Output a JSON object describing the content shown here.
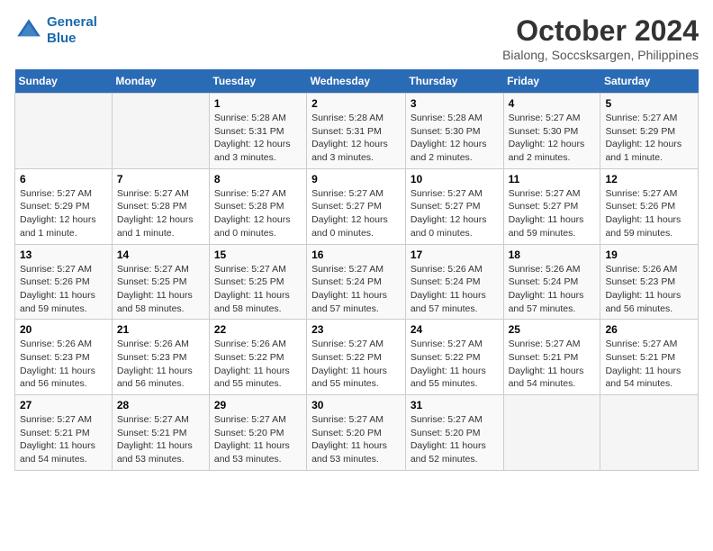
{
  "header": {
    "logo_line1": "General",
    "logo_line2": "Blue",
    "month": "October 2024",
    "location": "Bialong, Soccsksargen, Philippines"
  },
  "weekdays": [
    "Sunday",
    "Monday",
    "Tuesday",
    "Wednesday",
    "Thursday",
    "Friday",
    "Saturday"
  ],
  "weeks": [
    [
      {
        "day": "",
        "info": ""
      },
      {
        "day": "",
        "info": ""
      },
      {
        "day": "1",
        "info": "Sunrise: 5:28 AM\nSunset: 5:31 PM\nDaylight: 12 hours and 3 minutes."
      },
      {
        "day": "2",
        "info": "Sunrise: 5:28 AM\nSunset: 5:31 PM\nDaylight: 12 hours and 3 minutes."
      },
      {
        "day": "3",
        "info": "Sunrise: 5:28 AM\nSunset: 5:30 PM\nDaylight: 12 hours and 2 minutes."
      },
      {
        "day": "4",
        "info": "Sunrise: 5:27 AM\nSunset: 5:30 PM\nDaylight: 12 hours and 2 minutes."
      },
      {
        "day": "5",
        "info": "Sunrise: 5:27 AM\nSunset: 5:29 PM\nDaylight: 12 hours and 1 minute."
      }
    ],
    [
      {
        "day": "6",
        "info": "Sunrise: 5:27 AM\nSunset: 5:29 PM\nDaylight: 12 hours and 1 minute."
      },
      {
        "day": "7",
        "info": "Sunrise: 5:27 AM\nSunset: 5:28 PM\nDaylight: 12 hours and 1 minute."
      },
      {
        "day": "8",
        "info": "Sunrise: 5:27 AM\nSunset: 5:28 PM\nDaylight: 12 hours and 0 minutes."
      },
      {
        "day": "9",
        "info": "Sunrise: 5:27 AM\nSunset: 5:27 PM\nDaylight: 12 hours and 0 minutes."
      },
      {
        "day": "10",
        "info": "Sunrise: 5:27 AM\nSunset: 5:27 PM\nDaylight: 12 hours and 0 minutes."
      },
      {
        "day": "11",
        "info": "Sunrise: 5:27 AM\nSunset: 5:27 PM\nDaylight: 11 hours and 59 minutes."
      },
      {
        "day": "12",
        "info": "Sunrise: 5:27 AM\nSunset: 5:26 PM\nDaylight: 11 hours and 59 minutes."
      }
    ],
    [
      {
        "day": "13",
        "info": "Sunrise: 5:27 AM\nSunset: 5:26 PM\nDaylight: 11 hours and 59 minutes."
      },
      {
        "day": "14",
        "info": "Sunrise: 5:27 AM\nSunset: 5:25 PM\nDaylight: 11 hours and 58 minutes."
      },
      {
        "day": "15",
        "info": "Sunrise: 5:27 AM\nSunset: 5:25 PM\nDaylight: 11 hours and 58 minutes."
      },
      {
        "day": "16",
        "info": "Sunrise: 5:27 AM\nSunset: 5:24 PM\nDaylight: 11 hours and 57 minutes."
      },
      {
        "day": "17",
        "info": "Sunrise: 5:26 AM\nSunset: 5:24 PM\nDaylight: 11 hours and 57 minutes."
      },
      {
        "day": "18",
        "info": "Sunrise: 5:26 AM\nSunset: 5:24 PM\nDaylight: 11 hours and 57 minutes."
      },
      {
        "day": "19",
        "info": "Sunrise: 5:26 AM\nSunset: 5:23 PM\nDaylight: 11 hours and 56 minutes."
      }
    ],
    [
      {
        "day": "20",
        "info": "Sunrise: 5:26 AM\nSunset: 5:23 PM\nDaylight: 11 hours and 56 minutes."
      },
      {
        "day": "21",
        "info": "Sunrise: 5:26 AM\nSunset: 5:23 PM\nDaylight: 11 hours and 56 minutes."
      },
      {
        "day": "22",
        "info": "Sunrise: 5:26 AM\nSunset: 5:22 PM\nDaylight: 11 hours and 55 minutes."
      },
      {
        "day": "23",
        "info": "Sunrise: 5:27 AM\nSunset: 5:22 PM\nDaylight: 11 hours and 55 minutes."
      },
      {
        "day": "24",
        "info": "Sunrise: 5:27 AM\nSunset: 5:22 PM\nDaylight: 11 hours and 55 minutes."
      },
      {
        "day": "25",
        "info": "Sunrise: 5:27 AM\nSunset: 5:21 PM\nDaylight: 11 hours and 54 minutes."
      },
      {
        "day": "26",
        "info": "Sunrise: 5:27 AM\nSunset: 5:21 PM\nDaylight: 11 hours and 54 minutes."
      }
    ],
    [
      {
        "day": "27",
        "info": "Sunrise: 5:27 AM\nSunset: 5:21 PM\nDaylight: 11 hours and 54 minutes."
      },
      {
        "day": "28",
        "info": "Sunrise: 5:27 AM\nSunset: 5:21 PM\nDaylight: 11 hours and 53 minutes."
      },
      {
        "day": "29",
        "info": "Sunrise: 5:27 AM\nSunset: 5:20 PM\nDaylight: 11 hours and 53 minutes."
      },
      {
        "day": "30",
        "info": "Sunrise: 5:27 AM\nSunset: 5:20 PM\nDaylight: 11 hours and 53 minutes."
      },
      {
        "day": "31",
        "info": "Sunrise: 5:27 AM\nSunset: 5:20 PM\nDaylight: 11 hours and 52 minutes."
      },
      {
        "day": "",
        "info": ""
      },
      {
        "day": "",
        "info": ""
      }
    ]
  ]
}
